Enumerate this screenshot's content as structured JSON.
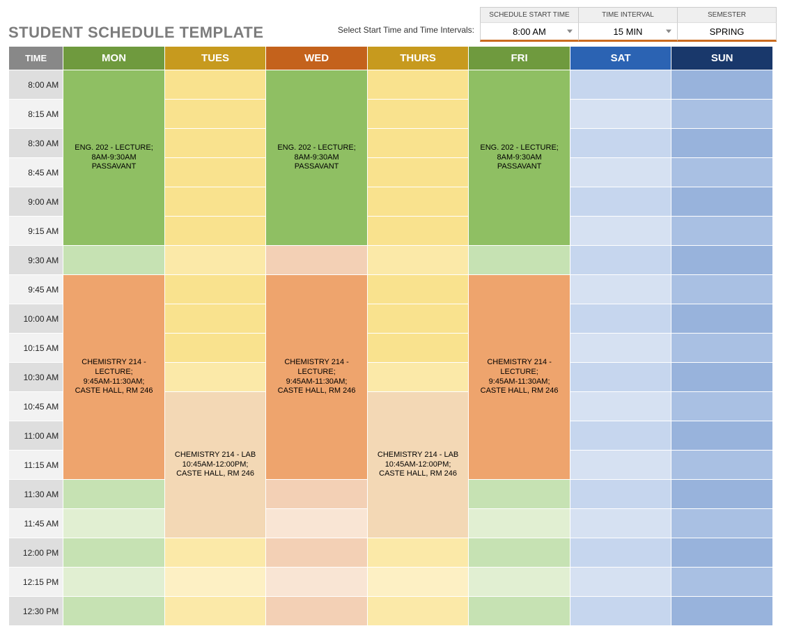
{
  "header": {
    "title": "STUDENT SCHEDULE TEMPLATE",
    "hint": "Select Start Time and Time Intervals:",
    "controls": {
      "start_time": {
        "label": "SCHEDULE START TIME",
        "value": "8:00 AM"
      },
      "interval": {
        "label": "TIME INTERVAL",
        "value": "15 MIN"
      },
      "semester": {
        "label": "SEMESTER",
        "value": "SPRING"
      }
    }
  },
  "columns": {
    "time": "TIME",
    "mon": "MON",
    "tue": "TUES",
    "wed": "WED",
    "thu": "THURS",
    "fri": "FRI",
    "sat": "SAT",
    "sun": "SUN"
  },
  "times": [
    "8:00 AM",
    "8:15 AM",
    "8:30 AM",
    "8:45 AM",
    "9:00 AM",
    "9:15 AM",
    "9:30 AM",
    "9:45 AM",
    "10:00 AM",
    "10:15 AM",
    "10:30 AM",
    "10:45 AM",
    "11:00 AM",
    "11:15 AM",
    "11:30 AM",
    "11:45 AM",
    "12:00 PM",
    "12:15 PM",
    "12:30 PM"
  ],
  "events": {
    "eng202": "ENG. 202 - LECTURE;\n8AM-9:30AM\nPASSAVANT",
    "chem_lec": "CHEMISTRY 214 - LECTURE;\n9:45AM-11:30AM;\nCASTE HALL, RM 246",
    "chem_lab": "CHEMISTRY 214 - LAB\n10:45AM-12:00PM;\nCASTE HALL, RM 246"
  }
}
